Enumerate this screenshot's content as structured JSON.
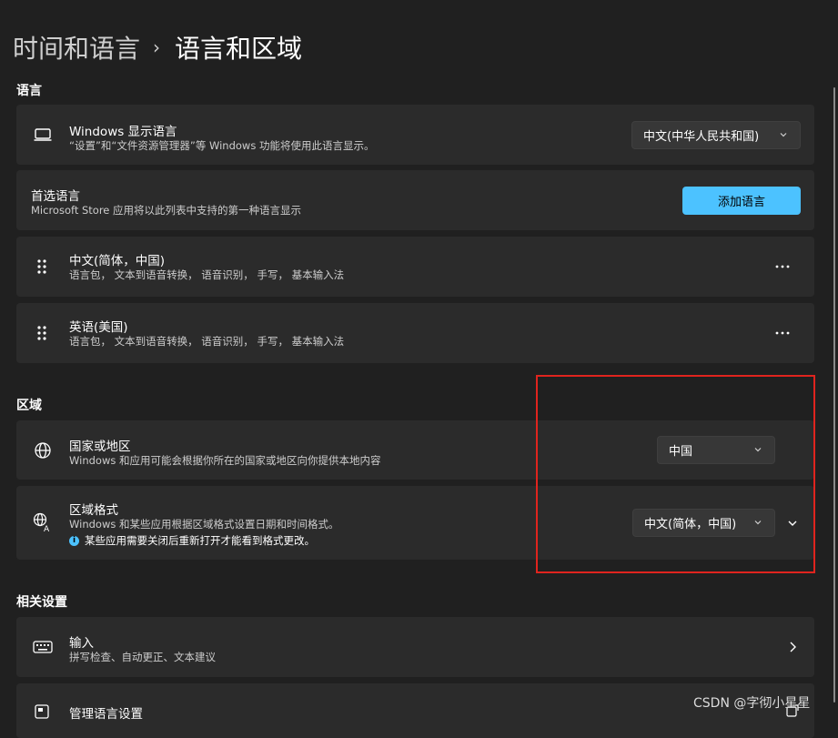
{
  "breadcrumb": {
    "parent": "时间和语言",
    "separator": "›",
    "current": "语言和区域"
  },
  "sections": {
    "language": "语言",
    "region": "区域",
    "related": "相关设置"
  },
  "display_language": {
    "title": "Windows 显示语言",
    "subtitle": "“设置”和“文件资源管理器”等 Windows 功能将使用此语言显示。",
    "value": "中文(中华人民共和国)",
    "icon": "monitor-icon"
  },
  "preferred": {
    "title": "首选语言",
    "subtitle": "Microsoft Store 应用将以此列表中支持的第一种语言显示",
    "button": "添加语言"
  },
  "languages": [
    {
      "name": "中文(简体，中国)",
      "features": "语言包， 文本到语音转换， 语音识别， 手写， 基本输入法"
    },
    {
      "name": "英语(美国)",
      "features": "语言包， 文本到语音转换， 语音识别， 手写， 基本输入法"
    }
  ],
  "country": {
    "title": "国家或地区",
    "subtitle": "Windows 和应用可能会根据你所在的国家或地区向你提供本地内容",
    "value": "中国",
    "icon": "globe-icon"
  },
  "regional_format": {
    "title": "区域格式",
    "subtitle": "Windows 和某些应用根据区域格式设置日期和时间格式。",
    "notice": "某些应用需要关闭后重新打开才能看到格式更改。",
    "value": "中文(简体，中国)",
    "icon": "regional-format-icon"
  },
  "related": [
    {
      "title": "输入",
      "subtitle": "拼写检查、自动更正、文本建议",
      "icon": "keyboard-icon"
    },
    {
      "title": "管理语言设置",
      "icon": "admin-language-icon"
    }
  ],
  "watermark": "CSDN @字彻小星星",
  "colors": {
    "accent": "#4cc2ff",
    "card": "#2b2b2b",
    "background": "#202020",
    "highlight": "#e0241e"
  }
}
